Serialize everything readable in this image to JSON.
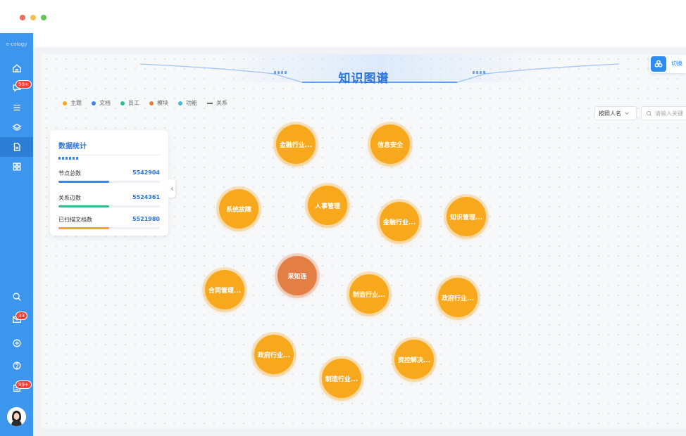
{
  "window": {
    "dots": [
      "#ef6a5e",
      "#f4bf4f",
      "#61c554"
    ]
  },
  "sidebar": {
    "brand": "e-cology",
    "badges": {
      "messages": "99+",
      "mail": "33",
      "notices": "99+"
    },
    "icons": [
      "home-icon",
      "chat-icon",
      "list-icon",
      "layers-icon",
      "document-icon",
      "apps-icon",
      "search-icon",
      "mail-icon",
      "plus-circle-icon",
      "help-icon",
      "notice-icon"
    ]
  },
  "header": {
    "title": "知识图谱",
    "toggle_label": "切换"
  },
  "legend": [
    {
      "label": "主题",
      "color": "#f8a81d"
    },
    {
      "label": "文档",
      "color": "#3b86e8"
    },
    {
      "label": "员工",
      "color": "#2fc08a"
    },
    {
      "label": "模块",
      "color": "#e37e45"
    },
    {
      "label": "功能",
      "color": "#4db6d6"
    },
    {
      "label": "关系",
      "color": "#666666"
    }
  ],
  "search": {
    "select_value": "按照人名",
    "placeholder": "请输入关键"
  },
  "stats": {
    "title": "数据统计",
    "rows": [
      {
        "label": "节点总数",
        "value": "5542904",
        "color": "#3b86e8",
        "fill": 0.5
      },
      {
        "label": "关系边数",
        "value": "5524361",
        "color": "#2fc08a",
        "fill": 0.5
      },
      {
        "label": "已扫描文档数",
        "value": "5521980",
        "color": "#f8a81d",
        "fill": 0.5
      }
    ]
  },
  "nodes": [
    {
      "label": "金融行业...",
      "type": "module"
    },
    {
      "label": "信息安全",
      "type": "module"
    },
    {
      "label": "系统故障",
      "type": "module"
    },
    {
      "label": "人事管理",
      "type": "module"
    },
    {
      "label": "金融行业...",
      "type": "module"
    },
    {
      "label": "知识管理...",
      "type": "module"
    },
    {
      "label": "采知连",
      "type": "employee"
    },
    {
      "label": "合同管理...",
      "type": "module"
    },
    {
      "label": "制造行业...",
      "type": "module"
    },
    {
      "label": "政府行业...",
      "type": "module"
    },
    {
      "label": "政府行业...",
      "type": "module"
    },
    {
      "label": "资控解决...",
      "type": "module"
    },
    {
      "label": "制造行业...",
      "type": "module"
    }
  ]
}
